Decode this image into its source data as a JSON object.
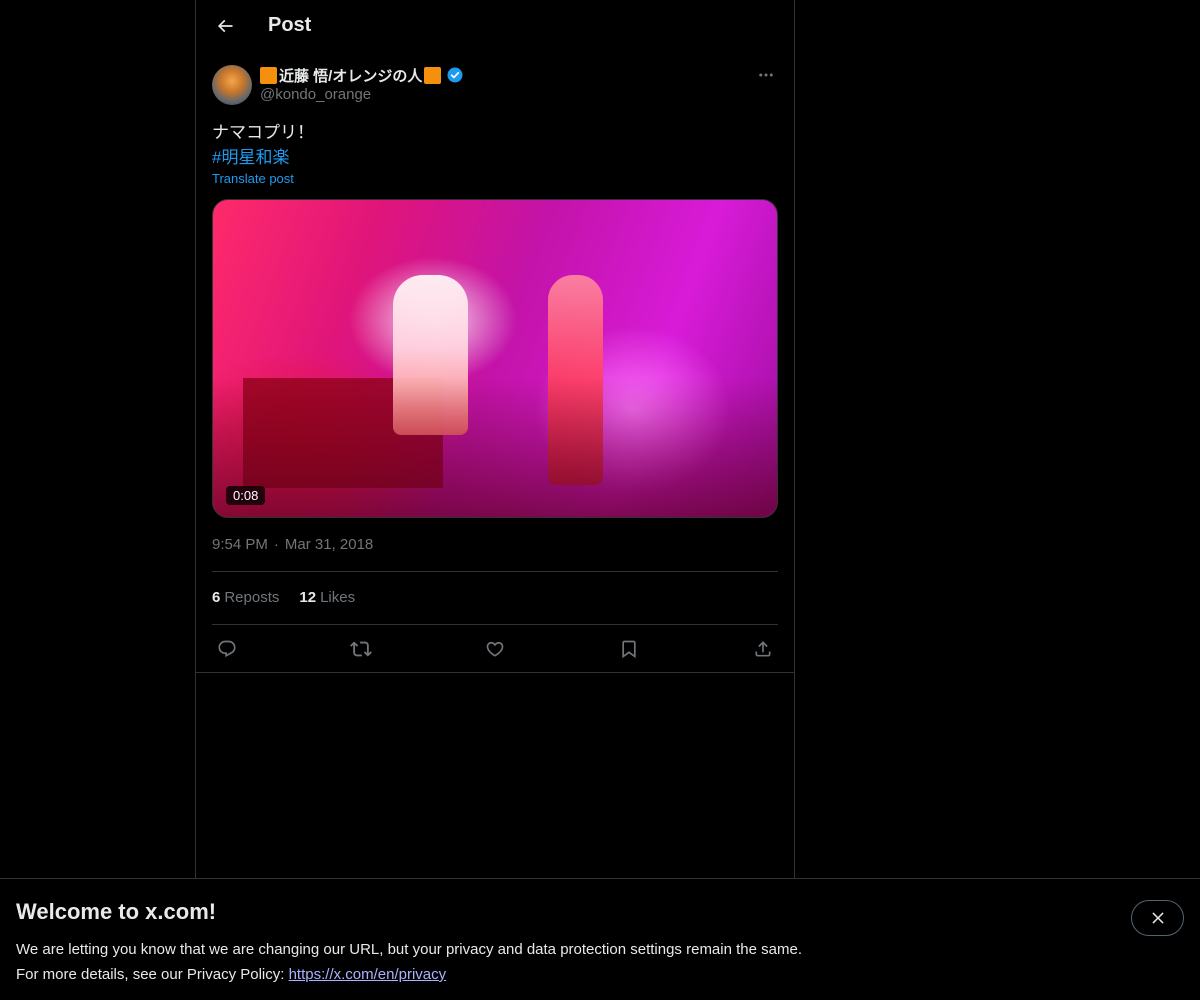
{
  "header": {
    "title": "Post"
  },
  "post": {
    "author_name": "近藤 悟/オレンジの人",
    "handle": "@kondo_orange",
    "text": "ナマコプリ！",
    "hashtag": "#明星和楽",
    "translate_label": "Translate post",
    "video_duration": "0:08",
    "time": "9:54 PM",
    "separator": "·",
    "date": "Mar 31, 2018",
    "reposts_count": "6",
    "reposts_label": "Reposts",
    "likes_count": "12",
    "likes_label": "Likes"
  },
  "banner": {
    "title": "Welcome to x.com!",
    "line1": "We are letting you know that we are changing our URL, but your privacy and data protection settings remain the same.",
    "line2_prefix": "For more details, see our Privacy Policy: ",
    "link": "https://x.com/en/privacy"
  },
  "colors": {
    "background": "#000000",
    "accent": "#1d9bf0",
    "muted": "#71767b",
    "border": "#2f3336",
    "brand_square": "#f4900c"
  },
  "icons": {
    "back": "arrow-left-icon",
    "verified": "verified-badge-icon",
    "more": "more-horizontal-icon",
    "reply": "reply-icon",
    "repost": "repost-icon",
    "like": "heart-icon",
    "bookmark": "bookmark-icon",
    "share": "share-icon",
    "close": "close-icon"
  }
}
